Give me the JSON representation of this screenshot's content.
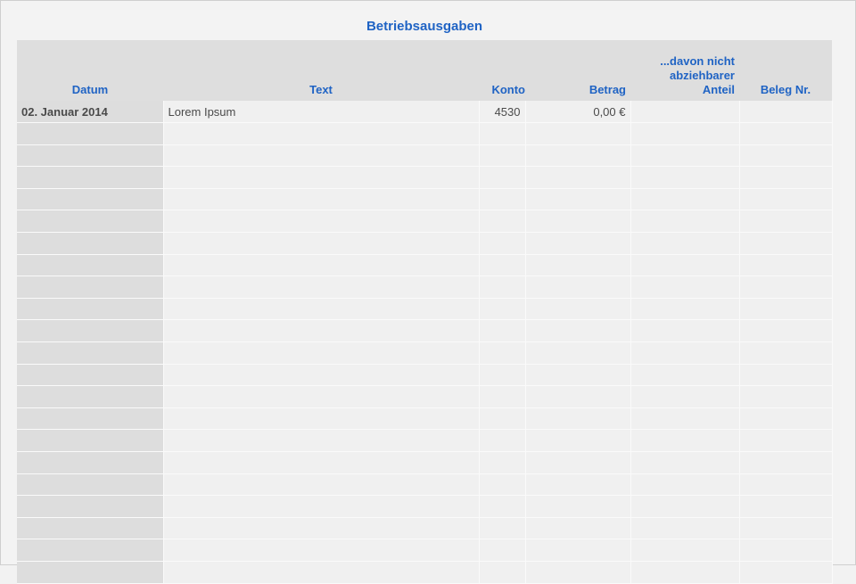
{
  "title": "Betriebsausgaben",
  "columns": {
    "datum": "Datum",
    "text": "Text",
    "konto": "Konto",
    "betrag": "Betrag",
    "anteil_line1": "...davon nicht",
    "anteil_line2": "abziehbarer",
    "anteil_line3": "Anteil",
    "beleg": "Beleg Nr."
  },
  "rows": [
    {
      "datum": "02. Januar 2014",
      "text": "Lorem Ipsum",
      "konto": "4530",
      "betrag": "0,00 €",
      "anteil": "",
      "beleg": ""
    }
  ],
  "empty_row_count": 21,
  "colors": {
    "accent": "#1f63c4",
    "header_bg": "#dedede",
    "date_bg": "#dddddd",
    "cell_bg": "#f0f0f0"
  }
}
